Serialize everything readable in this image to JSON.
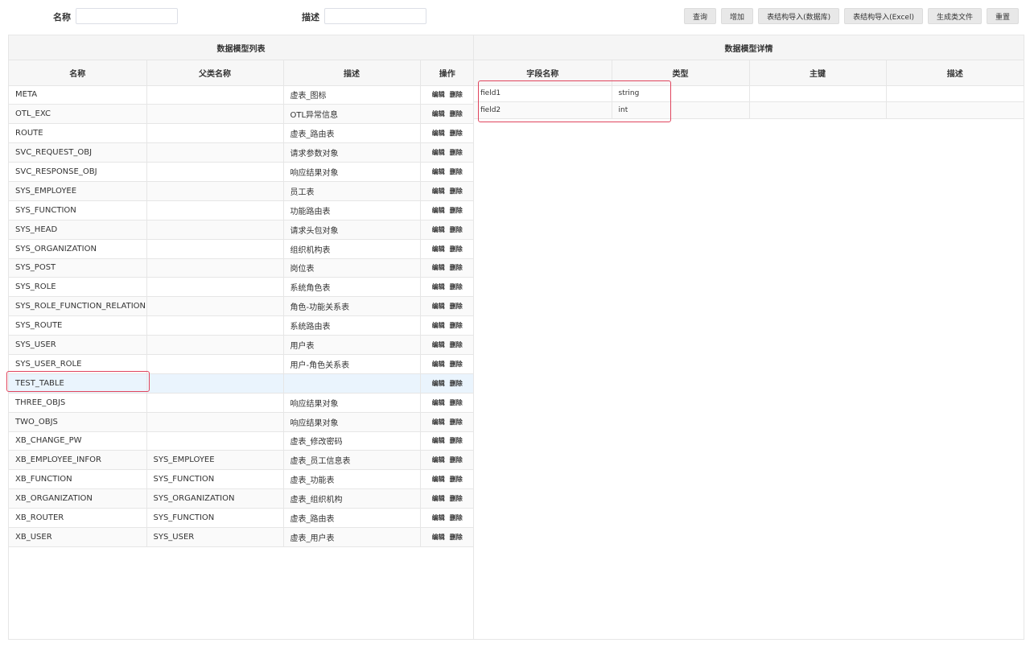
{
  "search": {
    "name_label": "名称",
    "name_value": "",
    "desc_label": "描述",
    "desc_value": ""
  },
  "toolbar": {
    "query": "查询",
    "add": "增加",
    "import_db": "表结构导入(数据库)",
    "import_excel": "表结构导入(Excel)",
    "gen_class": "生成类文件",
    "reset": "重置"
  },
  "model_list": {
    "title": "数据模型列表",
    "columns": [
      "名称",
      "父类名称",
      "描述",
      "操作"
    ],
    "edit_label": "编辑",
    "delete_label": "删除",
    "selected_row": "TEST_TABLE",
    "rows": [
      {
        "name": "META",
        "parent": "",
        "desc": "虚表_图标"
      },
      {
        "name": "OTL_EXC",
        "parent": "",
        "desc": "OTL异常信息"
      },
      {
        "name": "ROUTE",
        "parent": "",
        "desc": "虚表_路由表"
      },
      {
        "name": "SVC_REQUEST_OBJ",
        "parent": "",
        "desc": "请求参数对象"
      },
      {
        "name": "SVC_RESPONSE_OBJ",
        "parent": "",
        "desc": "响应结果对象"
      },
      {
        "name": "SYS_EMPLOYEE",
        "parent": "",
        "desc": "员工表"
      },
      {
        "name": "SYS_FUNCTION",
        "parent": "",
        "desc": "功能路由表"
      },
      {
        "name": "SYS_HEAD",
        "parent": "",
        "desc": "请求头包对象"
      },
      {
        "name": "SYS_ORGANIZATION",
        "parent": "",
        "desc": "组织机构表"
      },
      {
        "name": "SYS_POST",
        "parent": "",
        "desc": "岗位表"
      },
      {
        "name": "SYS_ROLE",
        "parent": "",
        "desc": "系统角色表"
      },
      {
        "name": "SYS_ROLE_FUNCTION_RELATION",
        "parent": "",
        "desc": "角色-功能关系表"
      },
      {
        "name": "SYS_ROUTE",
        "parent": "",
        "desc": "系统路由表"
      },
      {
        "name": "SYS_USER",
        "parent": "",
        "desc": "用户表"
      },
      {
        "name": "SYS_USER_ROLE",
        "parent": "",
        "desc": "用户-角色关系表"
      },
      {
        "name": "TEST_TABLE",
        "parent": "",
        "desc": ""
      },
      {
        "name": "THREE_OBJS",
        "parent": "",
        "desc": "响应结果对象"
      },
      {
        "name": "TWO_OBJS",
        "parent": "",
        "desc": "响应结果对象"
      },
      {
        "name": "XB_CHANGE_PW",
        "parent": "",
        "desc": "虚表_修改密码"
      },
      {
        "name": "XB_EMPLOYEE_INFOR",
        "parent": "SYS_EMPLOYEE",
        "desc": "虚表_员工信息表"
      },
      {
        "name": "XB_FUNCTION",
        "parent": "SYS_FUNCTION",
        "desc": "虚表_功能表"
      },
      {
        "name": "XB_ORGANIZATION",
        "parent": "SYS_ORGANIZATION",
        "desc": "虚表_组织机构"
      },
      {
        "name": "XB_ROUTER",
        "parent": "SYS_FUNCTION",
        "desc": "虚表_路由表"
      },
      {
        "name": "XB_USER",
        "parent": "SYS_USER",
        "desc": "虚表_用户表"
      }
    ]
  },
  "model_detail": {
    "title": "数据模型详情",
    "columns": [
      "字段名称",
      "类型",
      "主键",
      "描述"
    ],
    "rows": [
      {
        "field": "field1",
        "type": "string",
        "pk": "",
        "desc": ""
      },
      {
        "field": "field2",
        "type": "int",
        "pk": "",
        "desc": ""
      }
    ]
  },
  "colors": {
    "highlight_border": "#e0455e",
    "selected_row_bg": "#eaf4fd"
  }
}
